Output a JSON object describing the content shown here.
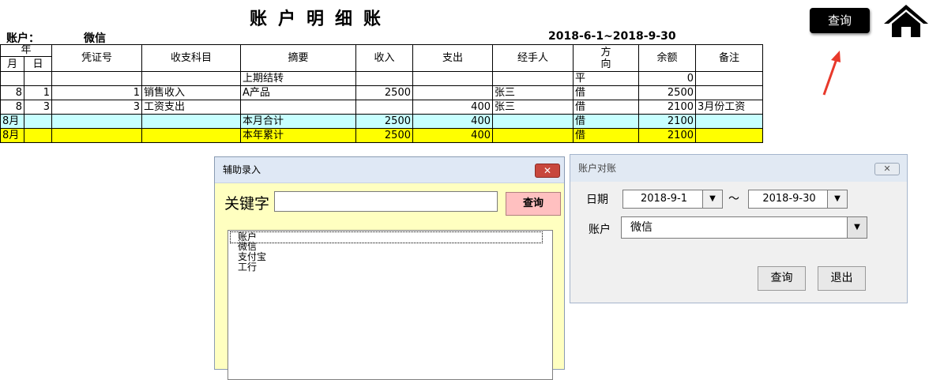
{
  "ledger": {
    "title": "账户明细账",
    "account_label": "账户：",
    "account_name": "微信",
    "date_range": "2018-6-1~2018-9-30",
    "headers": {
      "year": "年",
      "month": "月",
      "day": "日",
      "voucher": "凭证号",
      "subject": "收支科目",
      "summary": "摘要",
      "income": "收入",
      "expense": "支出",
      "handler": "经手人",
      "direction_1": "方",
      "direction_2": "向",
      "balance": "余额",
      "note": "备注"
    },
    "rows": [
      {
        "month": "",
        "day": "",
        "voucher": "",
        "subject": "",
        "summary": "上期结转",
        "income": "",
        "expense": "",
        "handler": "",
        "direction": "平",
        "balance": "0",
        "note": ""
      },
      {
        "month": "8",
        "day": "1",
        "voucher": "1",
        "subject": "销售收入",
        "summary": "A产品",
        "income": "2500",
        "expense": "",
        "handler": "张三",
        "direction": "借",
        "balance": "2500",
        "note": ""
      },
      {
        "month": "8",
        "day": "3",
        "voucher": "3",
        "subject": "工资支出",
        "summary": "",
        "income": "",
        "expense": "400",
        "handler": "张三",
        "direction": "借",
        "balance": "2100",
        "note": "3月份工资"
      }
    ],
    "month_total": {
      "month": "8月",
      "summary": "本月合计",
      "income": "2500",
      "expense": "400",
      "direction": "借",
      "balance": "2100"
    },
    "year_total": {
      "month": "8月",
      "summary": "本年累计",
      "income": "2500",
      "expense": "400",
      "direction": "借",
      "balance": "2100"
    }
  },
  "toolbar": {
    "query_label": "查询"
  },
  "assist_dialog": {
    "title": "辅助录入",
    "keyword_label": "关键字",
    "keyword_value": "",
    "query_label": "查询",
    "list_items": [
      "账户",
      "微信",
      "支付宝",
      "工行"
    ],
    "close_glyph": "✕"
  },
  "reconcile_dialog": {
    "title": "账户对账",
    "date_label": "日期",
    "date_from": "2018-9-1",
    "tilde": "～",
    "date_to": "2018-9-30",
    "account_label": "账户",
    "account_value": "微信",
    "query_label": "查询",
    "exit_label": "退出",
    "close_glyph": "✕"
  },
  "colors": {
    "month_total_bg": "#c7ffff",
    "year_total_bg": "#ffff00",
    "arrow": "#e8392b"
  }
}
